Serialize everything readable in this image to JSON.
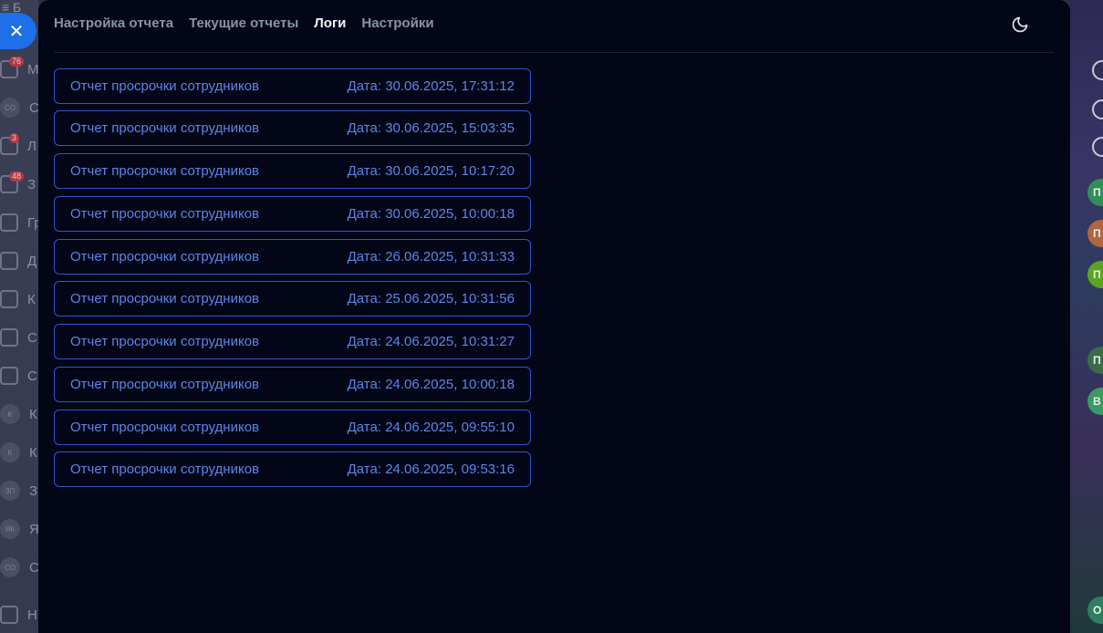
{
  "background": {
    "left_topbar": "≡ Б",
    "sidebar": [
      {
        "kind": "icon",
        "icon": "chat-icon",
        "text": "М",
        "badge": "76"
      },
      {
        "kind": "avatar",
        "avatar": "CO",
        "text": "С"
      },
      {
        "kind": "icon",
        "icon": "document-icon",
        "text": "Л",
        "badge": "3"
      },
      {
        "kind": "icon",
        "icon": "checkbox-icon",
        "text": "З",
        "badge": "48"
      },
      {
        "kind": "icon",
        "icon": "group-icon",
        "text": "Гр"
      },
      {
        "kind": "icon",
        "icon": "drive-icon",
        "text": "Д"
      },
      {
        "kind": "icon",
        "icon": "calendar-icon",
        "text": "К"
      },
      {
        "kind": "icon",
        "icon": "filter-icon",
        "text": "С"
      },
      {
        "kind": "icon",
        "icon": "card-icon",
        "text": "С"
      },
      {
        "kind": "avatar",
        "avatar": "К",
        "text": "К"
      },
      {
        "kind": "avatar",
        "avatar": "К",
        "text": "К"
      },
      {
        "kind": "avatar",
        "avatar": "ЗП",
        "text": "З"
      },
      {
        "kind": "avatar",
        "avatar": "ЯК",
        "text": "Я"
      },
      {
        "kind": "avatar",
        "avatar": "CO",
        "text": "С"
      },
      {
        "kind": "icon",
        "icon": "gear-icon",
        "text": "Н"
      }
    ],
    "right_strip": [
      {
        "text": "П",
        "color": "#2f8f5a"
      },
      {
        "text": "П",
        "color": "#b0663e"
      },
      {
        "text": "П",
        "color": "#5aa51f"
      },
      {
        "text": "П",
        "color": "#3c6b4a"
      },
      {
        "text": "В",
        "color": "#3b9a63"
      },
      {
        "text": "О",
        "color": "#2f7e62"
      }
    ]
  },
  "modal": {
    "close_symbol": "✕",
    "tabs": [
      {
        "label": "Настройка отчета",
        "active": false
      },
      {
        "label": "Текущие отчеты",
        "active": false
      },
      {
        "label": "Логи",
        "active": true
      },
      {
        "label": "Настройки",
        "active": false
      }
    ],
    "theme_icon": "moon-icon",
    "logs": [
      {
        "title": "Отчет просрочки сотрудников",
        "date": "Дата: 30.06.2025, 17:31:12"
      },
      {
        "title": "Отчет просрочки сотрудников",
        "date": "Дата: 30.06.2025, 15:03:35"
      },
      {
        "title": "Отчет просрочки сотрудников",
        "date": "Дата: 30.06.2025, 10:17:20"
      },
      {
        "title": "Отчет просрочки сотрудников",
        "date": "Дата: 30.06.2025, 10:00:18"
      },
      {
        "title": "Отчет просрочки сотрудников",
        "date": "Дата: 26.06.2025, 10:31:33"
      },
      {
        "title": "Отчет просрочки сотрудников",
        "date": "Дата: 25.06.2025, 10:31:56"
      },
      {
        "title": "Отчет просрочки сотрудников",
        "date": "Дата: 24.06.2025, 10:31:27"
      },
      {
        "title": "Отчет просрочки сотрудников",
        "date": "Дата: 24.06.2025, 10:00:18"
      },
      {
        "title": "Отчет просрочки сотрудников",
        "date": "Дата: 24.06.2025, 09:55:10"
      },
      {
        "title": "Отчет просрочки сотрудников",
        "date": "Дата: 24.06.2025, 09:53:16"
      }
    ]
  },
  "colors": {
    "modal_bg": "#020617",
    "log_border": "#2f55d4",
    "log_text": "#5d86e8",
    "close_button": "#1e6fe8"
  }
}
